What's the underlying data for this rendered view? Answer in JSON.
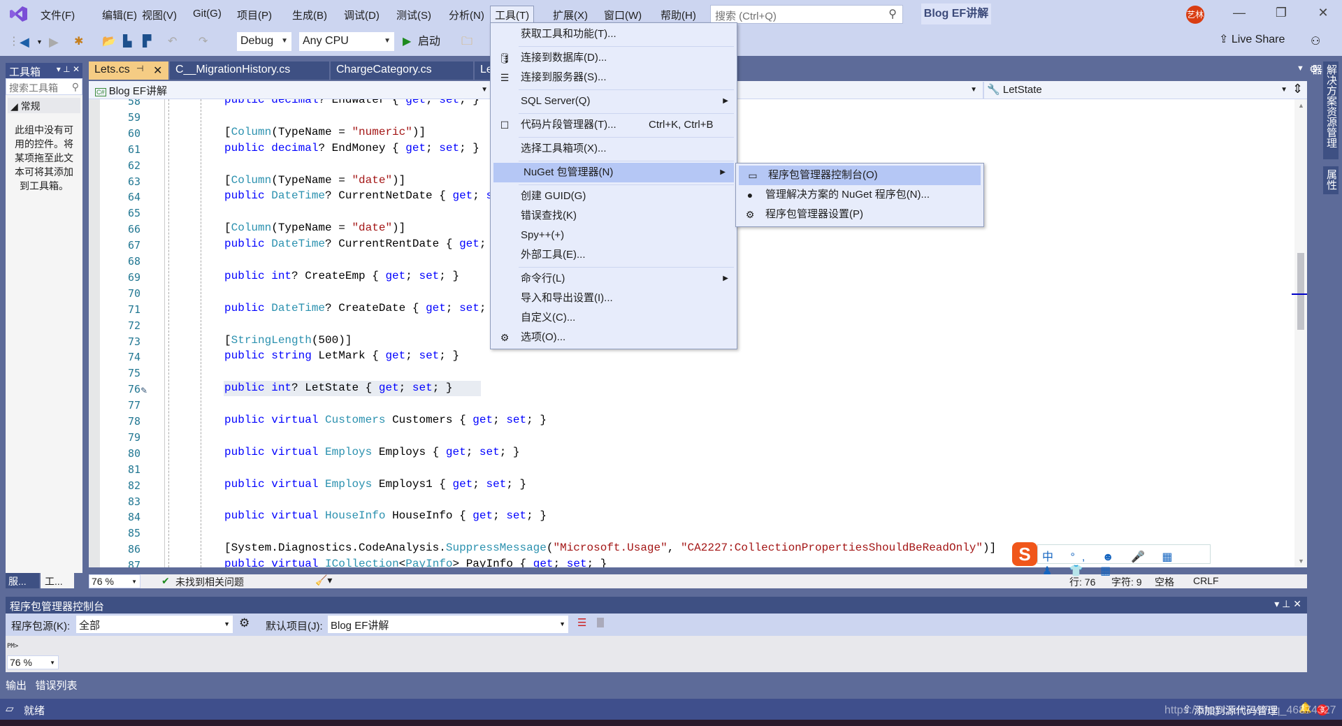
{
  "menubar": {
    "items": [
      "文件(F)",
      "编辑(E)",
      "视图(V)",
      "Git(G)",
      "项目(P)",
      "生成(B)",
      "调试(D)",
      "测试(S)",
      "分析(N)",
      "工具(T)",
      "扩展(X)",
      "窗口(W)",
      "帮助(H)"
    ],
    "active": "工具(T)"
  },
  "search": {
    "placeholder": "搜索 (Ctrl+Q)"
  },
  "solution_name": "Blog EF讲解",
  "user_avatar": "艺林",
  "toolbar": {
    "config": "Debug",
    "platform": "Any CPU",
    "start_label": "启动",
    "live_share": "Live Share"
  },
  "toolbox": {
    "title": "工具箱",
    "search_placeholder": "搜索工具箱",
    "group": "常规",
    "empty_text": "此组中没有可用的控件。将某项拖至此文本可将其添加到工具箱。",
    "bottom_tabs": [
      "服...",
      "工..."
    ]
  },
  "doc_tabs": [
    {
      "label": "Lets.cs",
      "active": true
    },
    {
      "label": "C__MigrationHistory.cs",
      "active": false
    },
    {
      "label": "ChargeCategory.cs",
      "active": false
    },
    {
      "label": "Let",
      "active": false
    }
  ],
  "navbar": {
    "project": "Blog EF讲解",
    "member": "LetState"
  },
  "code_lines": [
    {
      "n": "58",
      "html": "<span class='kw'>public</span> <span class='kw'>decimal</span>? EndWater { <span class='kw'>get</span>; <span class='kw'>set</span>; }"
    },
    {
      "n": "59",
      "html": ""
    },
    {
      "n": "60",
      "html": "[<span class='at'>Column</span>(TypeName = <span class='st'>\"numeric\"</span>)]"
    },
    {
      "n": "61",
      "html": "<span class='kw'>public</span> <span class='kw'>decimal</span>? EndMoney { <span class='kw'>get</span>; <span class='kw'>set</span>; }"
    },
    {
      "n": "62",
      "html": ""
    },
    {
      "n": "63",
      "html": "[<span class='at'>Column</span>(TypeName = <span class='st'>\"date\"</span>)]"
    },
    {
      "n": "64",
      "html": "<span class='kw'>public</span> <span class='ty'>DateTime</span>? CurrentNetDate { <span class='kw'>get</span>; <span class='kw'>set</span>; }"
    },
    {
      "n": "65",
      "html": ""
    },
    {
      "n": "66",
      "html": "[<span class='at'>Column</span>(TypeName = <span class='st'>\"date\"</span>)]"
    },
    {
      "n": "67",
      "html": "<span class='kw'>public</span> <span class='ty'>DateTime</span>? CurrentRentDate { <span class='kw'>get</span>; <span class='kw'>set</span>; }"
    },
    {
      "n": "68",
      "html": ""
    },
    {
      "n": "69",
      "html": "<span class='kw'>public</span> <span class='kw'>int</span>? CreateEmp { <span class='kw'>get</span>; <span class='kw'>set</span>; }"
    },
    {
      "n": "70",
      "html": ""
    },
    {
      "n": "71",
      "html": "<span class='kw'>public</span> <span class='ty'>DateTime</span>? CreateDate { <span class='kw'>get</span>; <span class='kw'>set</span>; }"
    },
    {
      "n": "72",
      "html": ""
    },
    {
      "n": "73",
      "html": "[<span class='at'>StringLength</span>(500)]"
    },
    {
      "n": "74",
      "html": "<span class='kw'>public</span> <span class='kw'>string</span> LetMark { <span class='kw'>get</span>; <span class='kw'>set</span>; }"
    },
    {
      "n": "75",
      "html": ""
    },
    {
      "n": "76",
      "html": "<span class='kw'>public</span> <span class='kw'>int</span>? LetState { <span class='kw'>get</span>; <span class='kw'>set</span>; }"
    },
    {
      "n": "77",
      "html": ""
    },
    {
      "n": "78",
      "html": "<span class='kw'>public</span> <span class='kw'>virtual</span> <span class='ty'>Customers</span> Customers { <span class='kw'>get</span>; <span class='kw'>set</span>; }"
    },
    {
      "n": "79",
      "html": ""
    },
    {
      "n": "80",
      "html": "<span class='kw'>public</span> <span class='kw'>virtual</span> <span class='ty'>Employs</span> Employs { <span class='kw'>get</span>; <span class='kw'>set</span>; }"
    },
    {
      "n": "81",
      "html": ""
    },
    {
      "n": "82",
      "html": "<span class='kw'>public</span> <span class='kw'>virtual</span> <span class='ty'>Employs</span> Employs1 { <span class='kw'>get</span>; <span class='kw'>set</span>; }"
    },
    {
      "n": "83",
      "html": ""
    },
    {
      "n": "84",
      "html": "<span class='kw'>public</span> <span class='kw'>virtual</span> <span class='ty'>HouseInfo</span> HouseInfo { <span class='kw'>get</span>; <span class='kw'>set</span>; }"
    },
    {
      "n": "85",
      "html": ""
    },
    {
      "n": "86",
      "html": "[System.Diagnostics.CodeAnalysis.<span class='at'>SuppressMessage</span>(<span class='st'>\"Microsoft.Usage\"</span>, <span class='st'>\"CA2227:CollectionPropertiesShouldBeReadOnly\"</span>)]"
    },
    {
      "n": "87",
      "html": "<span class='kw'>public</span> <span class='kw'>virtual</span> <span class='ty'>ICollection</span>&lt;<span class='ty'>PayInfo</span>&gt; PayInfo { <span class='kw'>get</span>; <span class='kw'>set</span>; }"
    }
  ],
  "editor_status": {
    "zoom": "76 %",
    "issues": "未找到相关问题",
    "line": "行: 76",
    "col": "字符: 9",
    "indent": "空格",
    "eol": "CRLF"
  },
  "right_rail": [
    "解决方案资源管理器",
    "属性"
  ],
  "tools_menu": [
    {
      "label": "获取工具和功能(T)...",
      "icon": ""
    },
    {
      "sep": true
    },
    {
      "label": "连接到数据库(D)...",
      "icon": "database-icon"
    },
    {
      "label": "连接到服务器(S)...",
      "icon": "server-icon"
    },
    {
      "sep": true
    },
    {
      "label": "SQL Server(Q)",
      "submenu": true
    },
    {
      "sep": true
    },
    {
      "label": "代码片段管理器(T)...",
      "icon": "snippet-icon",
      "shortcut": "Ctrl+K, Ctrl+B"
    },
    {
      "sep": true
    },
    {
      "label": "选择工具箱项(X)..."
    },
    {
      "sep": true
    },
    {
      "label": "NuGet 包管理器(N)",
      "submenu": true,
      "hover": true
    },
    {
      "sep": true
    },
    {
      "label": "创建 GUID(G)"
    },
    {
      "label": "错误查找(K)"
    },
    {
      "label": "Spy++(+)"
    },
    {
      "label": "外部工具(E)..."
    },
    {
      "sep": true
    },
    {
      "label": "命令行(L)",
      "submenu": true
    },
    {
      "label": "导入和导出设置(I)..."
    },
    {
      "label": "自定义(C)..."
    },
    {
      "label": "选项(O)...",
      "icon": "gear-icon"
    }
  ],
  "nuget_submenu": [
    {
      "label": "程序包管理器控制台(O)",
      "icon": "console-icon",
      "hover": true
    },
    {
      "label": "管理解决方案的 NuGet 程序包(N)...",
      "icon": "nuget-icon"
    },
    {
      "label": "程序包管理器设置(P)",
      "icon": "gear-icon"
    }
  ],
  "pmc": {
    "title": "程序包管理器控制台",
    "source_label": "程序包源(K):",
    "source_value": "全部",
    "project_label": "默认项目(J):",
    "project_value": "Blog EF讲解",
    "prompt": "PM>",
    "zoom": "76 %"
  },
  "bottom_tabs": [
    "输出",
    "错误列表"
  ],
  "statusbar": {
    "ready": "就绪",
    "source_control": "添加到源代码管理",
    "notifications": "3"
  },
  "ime": {
    "logo": "S",
    "items": "中 °, ☻ 🎤 ▦ ♟ 👕 ▦"
  },
  "watermark": "https://blog.csdn.net/qq_46874327"
}
